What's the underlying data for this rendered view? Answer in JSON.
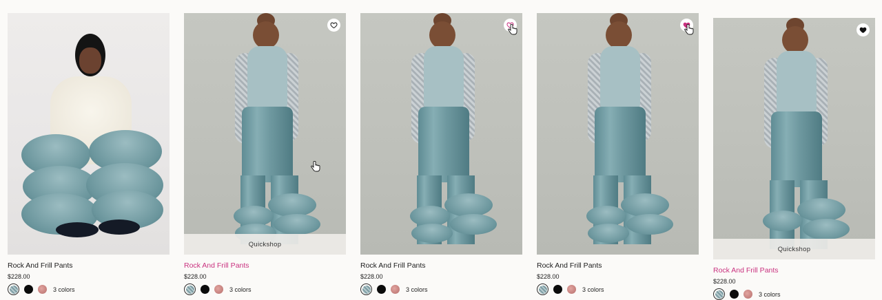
{
  "products": [
    {
      "title": "Rock And Frill Pants",
      "price": "$228.00",
      "colors_label": "3 colors",
      "quickshop_label": "",
      "title_hover": false,
      "heart": "none",
      "swatches": [
        "denim-blue",
        "black",
        "rose"
      ]
    },
    {
      "title": "Rock And Frill Pants",
      "price": "$228.00",
      "colors_label": "3 colors",
      "quickshop_label": "Quickshop",
      "title_hover": true,
      "heart": "outline",
      "swatches": [
        "denim-blue",
        "black",
        "rose"
      ]
    },
    {
      "title": "Rock And Frill Pants",
      "price": "$228.00",
      "colors_label": "3 colors",
      "quickshop_label": "",
      "title_hover": false,
      "heart": "outline-pink",
      "swatches": [
        "denim-blue",
        "black",
        "rose"
      ]
    },
    {
      "title": "Rock And Frill Pants",
      "price": "$228.00",
      "colors_label": "3 colors",
      "quickshop_label": "",
      "title_hover": false,
      "heart": "filled-pink",
      "swatches": [
        "denim-blue",
        "black",
        "rose"
      ]
    },
    {
      "title": "Rock And Frill Pants",
      "price": "$228.00",
      "colors_label": "3 colors",
      "quickshop_label": "Quickshop",
      "title_hover": true,
      "heart": "filled-black",
      "swatches": [
        "denim-blue",
        "black",
        "rose"
      ]
    }
  ],
  "colors": {
    "accent_pink": "#c9317f",
    "text": "#1c1c1c",
    "background": "#fbfaf8"
  }
}
